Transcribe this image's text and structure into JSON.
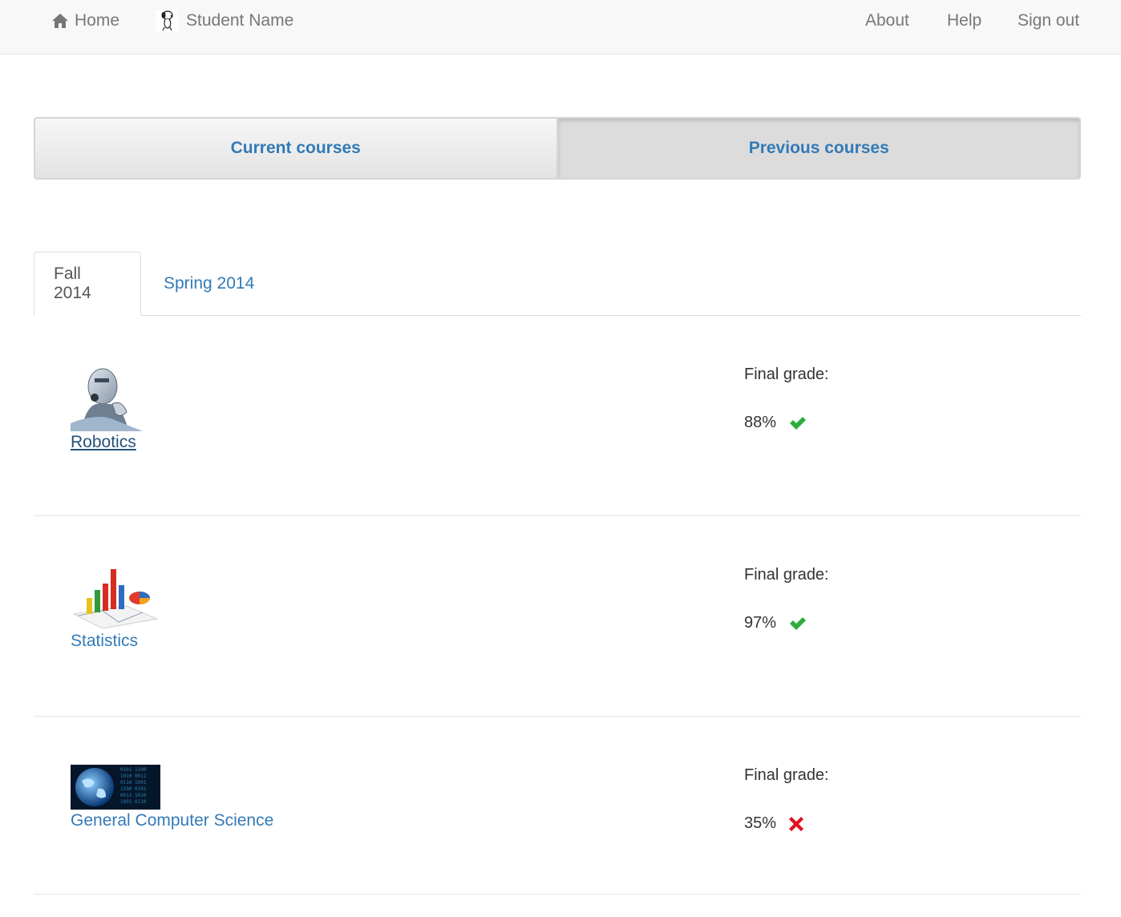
{
  "navbar": {
    "home_label": "Home",
    "user_name": "Student Name",
    "about_label": "About",
    "help_label": "Help",
    "signout_label": "Sign out"
  },
  "course_toggle": {
    "current_label": "Current courses",
    "previous_label": "Previous courses",
    "selected": "Previous courses"
  },
  "term_tabs": {
    "items": [
      {
        "label": "Fall 2014",
        "active": true
      },
      {
        "label": "Spring 2014",
        "active": false
      }
    ]
  },
  "courses": [
    {
      "name": "Robotics",
      "grade_label": "Final grade:",
      "grade": "88%",
      "status_icon": "check-icon",
      "status_color": "#2dac3c",
      "thumbnail": "robot-image"
    },
    {
      "name": "Statistics",
      "grade_label": "Final grade:",
      "grade": "97%",
      "status_icon": "check-icon",
      "status_color": "#2dac3c",
      "thumbnail": "bar-chart-image"
    },
    {
      "name": "General Computer Science",
      "grade_label": "Final grade:",
      "grade": "35%",
      "status_icon": "cross-icon",
      "status_color": "#e0131b",
      "thumbnail": "globe-image"
    }
  ],
  "colors": {
    "link": "#337ab7",
    "link_hover": "#23527c",
    "navbar_bg": "#f8f8f8",
    "nav_text": "#777777"
  }
}
